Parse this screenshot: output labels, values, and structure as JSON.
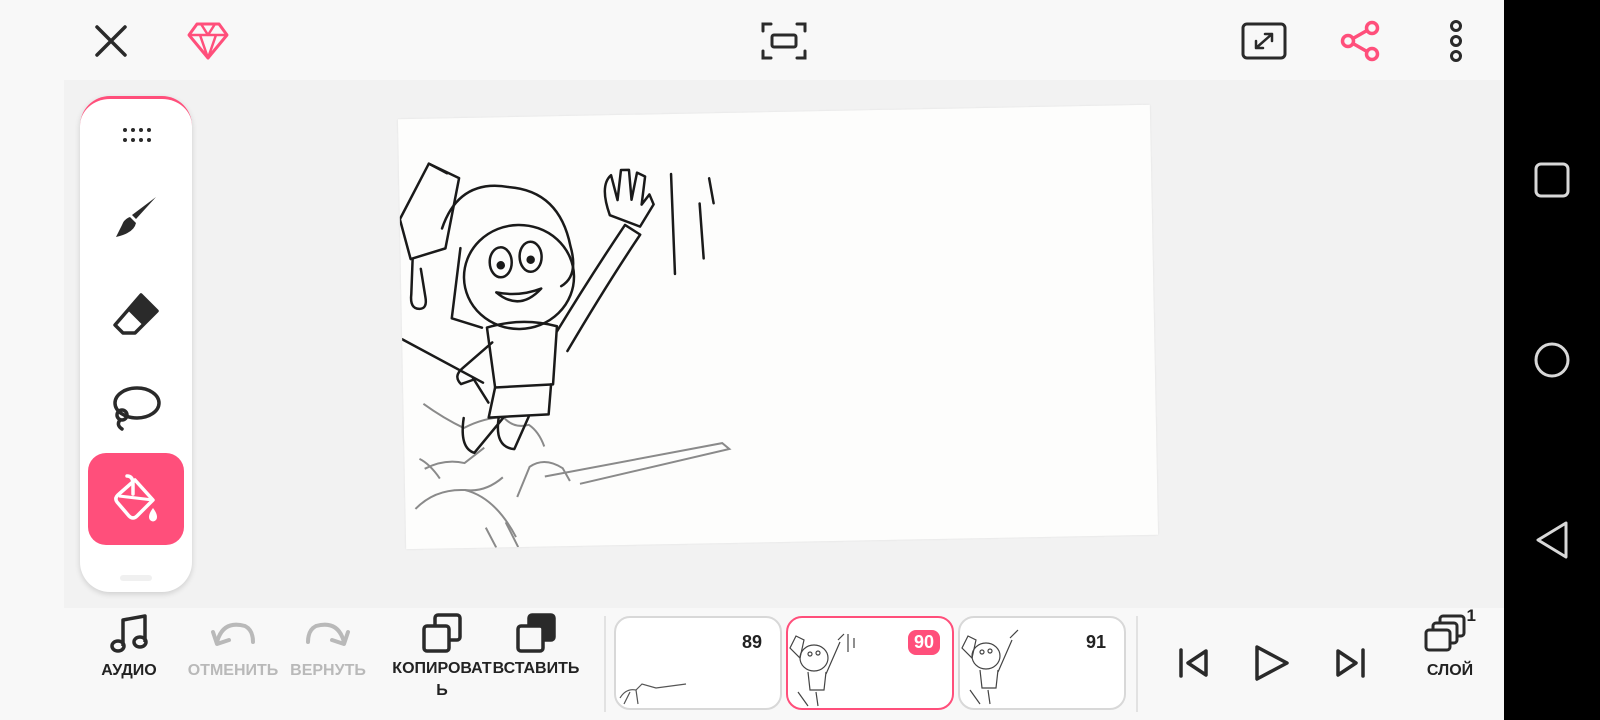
{
  "colors": {
    "accent": "#ff4f7b",
    "icon": "#2a2a2a",
    "disabled": "#b9b9b9"
  },
  "topbar": {
    "icons": [
      "close-icon",
      "premium-diamond-icon",
      "fit-frame-icon",
      "fullscreen-icon",
      "share-icon",
      "more-vertical-icon"
    ]
  },
  "tools": [
    {
      "name": "tool-menu",
      "icon": "dots-grip-icon"
    },
    {
      "name": "brush-tool",
      "icon": "brush-icon"
    },
    {
      "name": "eraser-tool",
      "icon": "eraser-icon"
    },
    {
      "name": "lasso-tool",
      "icon": "lasso-icon"
    },
    {
      "name": "fill-tool",
      "icon": "paint-bucket-icon",
      "active": true
    }
  ],
  "bottombar": {
    "audio_label": "АУДИО",
    "undo_label": "ОТМЕНИТЬ",
    "redo_label": "ВЕРНУТЬ",
    "copy_label_line1": "КОПИРОВАТ",
    "copy_label_line2": "Ь",
    "paste_label": "ВСТАВИТЬ",
    "layer_label": "СЛОЙ",
    "layer_count": "1"
  },
  "frames": [
    {
      "number": "89",
      "current": false
    },
    {
      "number": "90",
      "current": true
    },
    {
      "number": "91",
      "current": false
    }
  ],
  "playback": {
    "icons": [
      "skip-to-start-icon",
      "play-icon",
      "skip-to-end-icon"
    ]
  },
  "system_nav": {
    "icons": [
      "recents-square-icon",
      "home-circle-icon",
      "back-triangle-icon"
    ]
  }
}
